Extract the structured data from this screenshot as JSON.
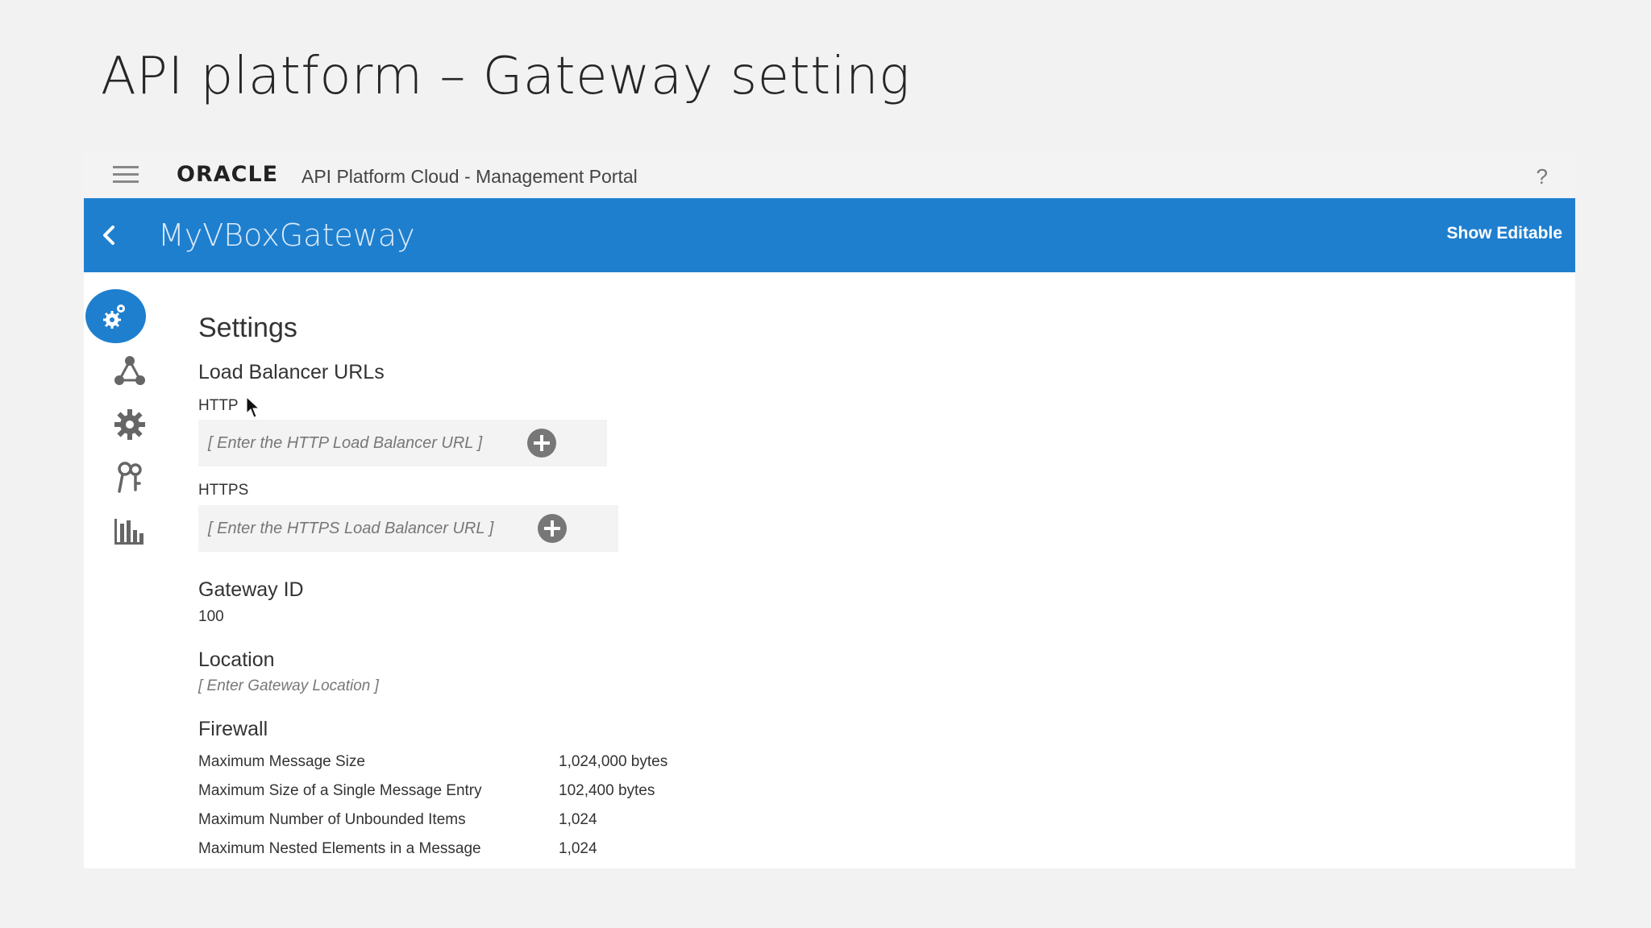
{
  "slide": {
    "title": "API platform – Gateway setting"
  },
  "topbar": {
    "brand": "ORACLE",
    "portal_name": "API Platform Cloud - Management Portal",
    "help_label": "?"
  },
  "header": {
    "gateway_name": "MyVBoxGateway",
    "show_editable_label": "Show Editable",
    "accent_color": "#1f7fcf"
  },
  "rail": {
    "items": [
      {
        "icon": "settings-gears-icon",
        "active": true
      },
      {
        "icon": "nodes-icon",
        "active": false
      },
      {
        "icon": "gear-icon",
        "active": false
      },
      {
        "icon": "keys-icon",
        "active": false
      },
      {
        "icon": "bar-chart-icon",
        "active": false
      }
    ]
  },
  "settings": {
    "title": "Settings",
    "load_balancer": {
      "title": "Load Balancer URLs",
      "http_label": "HTTP",
      "http_placeholder": "[ Enter the HTTP Load Balancer URL ]",
      "https_label": "HTTPS",
      "https_placeholder": "[ Enter the HTTPS Load Balancer URL ]"
    },
    "gateway_id": {
      "title": "Gateway ID",
      "value": "100"
    },
    "location": {
      "title": "Location",
      "placeholder": "[ Enter Gateway Location ]"
    },
    "firewall": {
      "title": "Firewall",
      "rows": [
        {
          "label": "Maximum Message Size",
          "value": "1,024,000  bytes"
        },
        {
          "label": "Maximum Size of a Single Message Entry",
          "value": "102,400  bytes"
        },
        {
          "label": "Maximum Number of Unbounded Items",
          "value": "1,024"
        },
        {
          "label": "Maximum Nested Elements in a Message",
          "value": "1,024"
        }
      ]
    }
  }
}
